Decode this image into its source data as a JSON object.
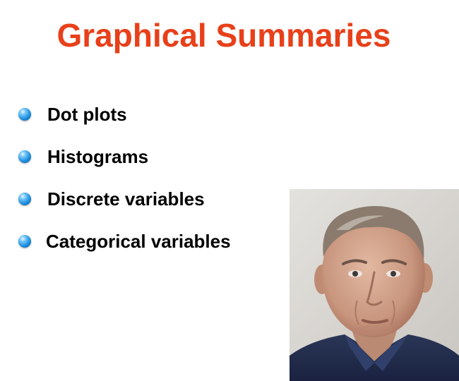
{
  "slide": {
    "title": "Graphical Summaries",
    "title_color": "#e8401a",
    "bullet_color": "#1b8ee0",
    "bullets": [
      {
        "label": "Dot plots"
      },
      {
        "label": "Histograms"
      },
      {
        "label": "Discrete variables"
      },
      {
        "label": "Categorical variables"
      }
    ],
    "photo": {
      "icon": "person-portrait-photo"
    }
  }
}
